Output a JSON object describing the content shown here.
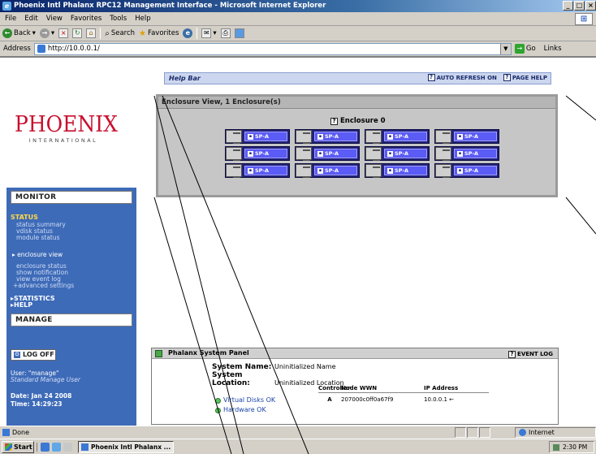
{
  "window": {
    "title": "Phoenix Intl Phalanx RPC12 Management Interface - Microsoft Internet Explorer",
    "min": "_",
    "max": "□",
    "close": "×"
  },
  "menu": [
    "File",
    "Edit",
    "View",
    "Favorites",
    "Tools",
    "Help"
  ],
  "toolbar": {
    "back": "Back",
    "search": "Search",
    "favorites": "Favorites"
  },
  "address": {
    "label": "Address",
    "url": "http://10.0.0.1/",
    "go": "Go",
    "links": "Links"
  },
  "brand": {
    "name": "PHOENIX",
    "sub": "INTERNATIONAL"
  },
  "sidebar": {
    "monitor": "MONITOR",
    "status_head": "STATUS",
    "status_items": [
      "status summary",
      "vdisk status",
      "module status"
    ],
    "enclosure_view": "▸ enclosure view",
    "more_items": [
      "enclosure status",
      "show notification",
      "view event log",
      "+advanced settings"
    ],
    "statistics": "▸STATISTICS",
    "help": "▸HELP",
    "manage": "MANAGE",
    "logoff": "LOG OFF",
    "user": "User: \"manage\"",
    "role": "Standard Manage User",
    "date": "Date: Jan 24 2008",
    "time": "Time: 14:29:23"
  },
  "helpbar": {
    "title": "Help Bar",
    "auto_refresh": "AUTO REFRESH ON",
    "page_help": "PAGE HELP"
  },
  "enclosure": {
    "title": "Enclosure View, 1 Enclosure(s)",
    "label": "Enclosure 0",
    "controller_label": "SP-A",
    "grid_rows": 3,
    "grid_cols": 4
  },
  "panel": {
    "title": "Phalanx System Panel",
    "event_log": "EVENT LOG",
    "system_name_key": "System Name:",
    "system_name": "Uninitialized Name",
    "system_location_key": "System Location:",
    "system_location": "Uninitialized Location",
    "table_headers": [
      "Controller",
      "Node WWN",
      "IP Address"
    ],
    "table_rows": [
      [
        "A",
        "207000c0ff0a67f9",
        "10.0.0.1 ←"
      ]
    ],
    "virtual_disks": "Virtual Disks OK",
    "hardware": "Hardware OK"
  },
  "statusbar": {
    "done": "Done",
    "zone": "Internet"
  },
  "taskbar": {
    "start": "Start",
    "task": "Phoenix Intl Phalanx ...",
    "clock": "2:30 PM"
  }
}
